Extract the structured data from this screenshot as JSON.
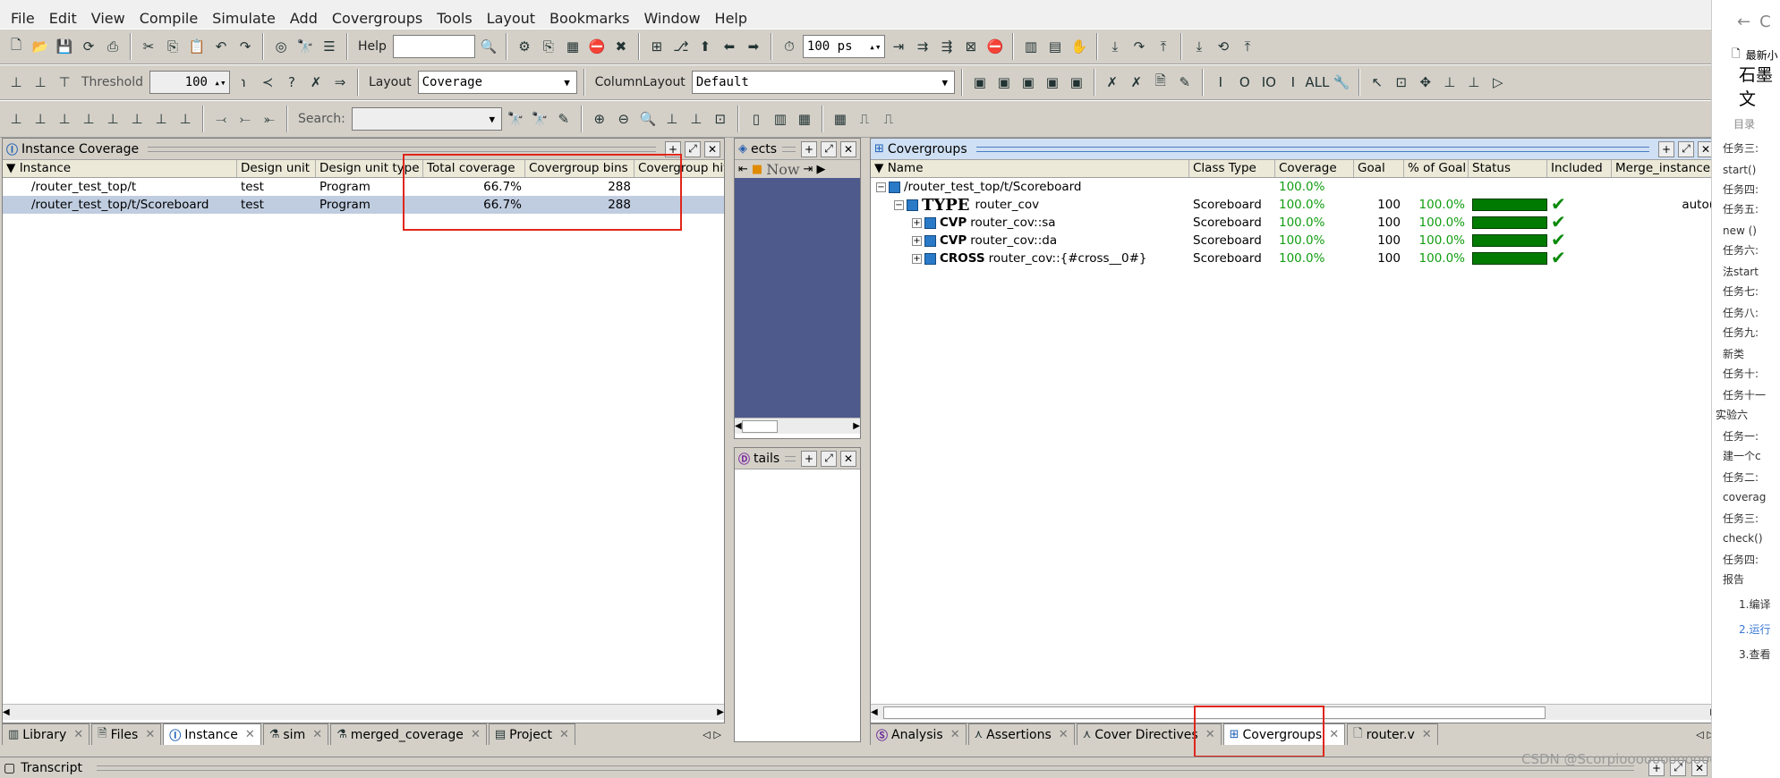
{
  "menu": [
    "File",
    "Edit",
    "View",
    "Compile",
    "Simulate",
    "Add",
    "Covergroups",
    "Tools",
    "Layout",
    "Bookmarks",
    "Window",
    "Help"
  ],
  "toolbar1": {
    "help_label": "Help",
    "time_value": "100 ps"
  },
  "toolbar2": {
    "threshold_label": "Threshold",
    "threshold_value": "100",
    "layout_label": "Layout",
    "layout_value": "Coverage",
    "column_layout_label": "ColumnLayout",
    "column_layout_value": "Default"
  },
  "toolbar3": {
    "search_label": "Search:"
  },
  "instance_pane": {
    "title": "Instance Coverage",
    "columns": [
      "Instance",
      "Design unit",
      "Design unit type",
      "Total coverage",
      "Covergroup bins",
      "Covergroup hit b"
    ],
    "rows": [
      {
        "instance": "/router_test_top/t",
        "design_unit": "test",
        "type": "Program",
        "total": "66.7%",
        "bins": "288"
      },
      {
        "instance": "/router_test_top/t/Scoreboard",
        "design_unit": "test",
        "type": "Program",
        "total": "66.7%",
        "bins": "288"
      }
    ]
  },
  "objects_pane": {
    "title": "ects",
    "now_label": "Now"
  },
  "details_pane": {
    "title": "tails"
  },
  "covergroups_pane": {
    "title": "Covergroups",
    "columns": [
      "Name",
      "Class Type",
      "Coverage",
      "Goal",
      "% of Goal",
      "Status",
      "Included",
      "Merge_instances"
    ],
    "root": {
      "name": "/router_test_top/t/Scoreboard",
      "coverage": "100.0%"
    },
    "type_row": {
      "kw": "TYPE",
      "name": "router_cov",
      "class": "Scoreboard",
      "coverage": "100.0%",
      "goal": "100",
      "pct": "100.0%",
      "merge": "auto("
    },
    "items": [
      {
        "kw": "CVP",
        "name": "router_cov::sa",
        "class": "Scoreboard",
        "coverage": "100.0%",
        "goal": "100",
        "pct": "100.0%"
      },
      {
        "kw": "CVP",
        "name": "router_cov::da",
        "class": "Scoreboard",
        "coverage": "100.0%",
        "goal": "100",
        "pct": "100.0%"
      },
      {
        "kw": "CROSS",
        "name": "router_cov::{#cross__0#}",
        "class": "Scoreboard",
        "coverage": "100.0%",
        "goal": "100",
        "pct": "100.0%"
      }
    ]
  },
  "left_tabs": [
    "Library",
    "Files",
    "Instance",
    "sim",
    "merged_coverage",
    "Project"
  ],
  "right_tabs": [
    "Analysis",
    "Assertions",
    "Cover Directives",
    "Covergroups",
    "router.v"
  ],
  "transcript_title": "Transcript",
  "watermark": "CSDN @Scorpiooooooooooooooooooo",
  "side_panel": {
    "title": "石墨文",
    "recent": "最新小",
    "toc_label": "目录",
    "items": [
      "任务三:",
      "start()",
      "任务四:",
      "任务五:",
      "new ()",
      "任务六:",
      "法start",
      "任务七:",
      "任务八:",
      "任务九:",
      "新类",
      "任务十:",
      "任务十一",
      "实验六",
      "任务一:",
      "建一个c",
      "任务二:",
      "coverag",
      "任务三:",
      "check()",
      "任务四:",
      "报告",
      "1.编译",
      "2.运行",
      "3.查看"
    ]
  }
}
